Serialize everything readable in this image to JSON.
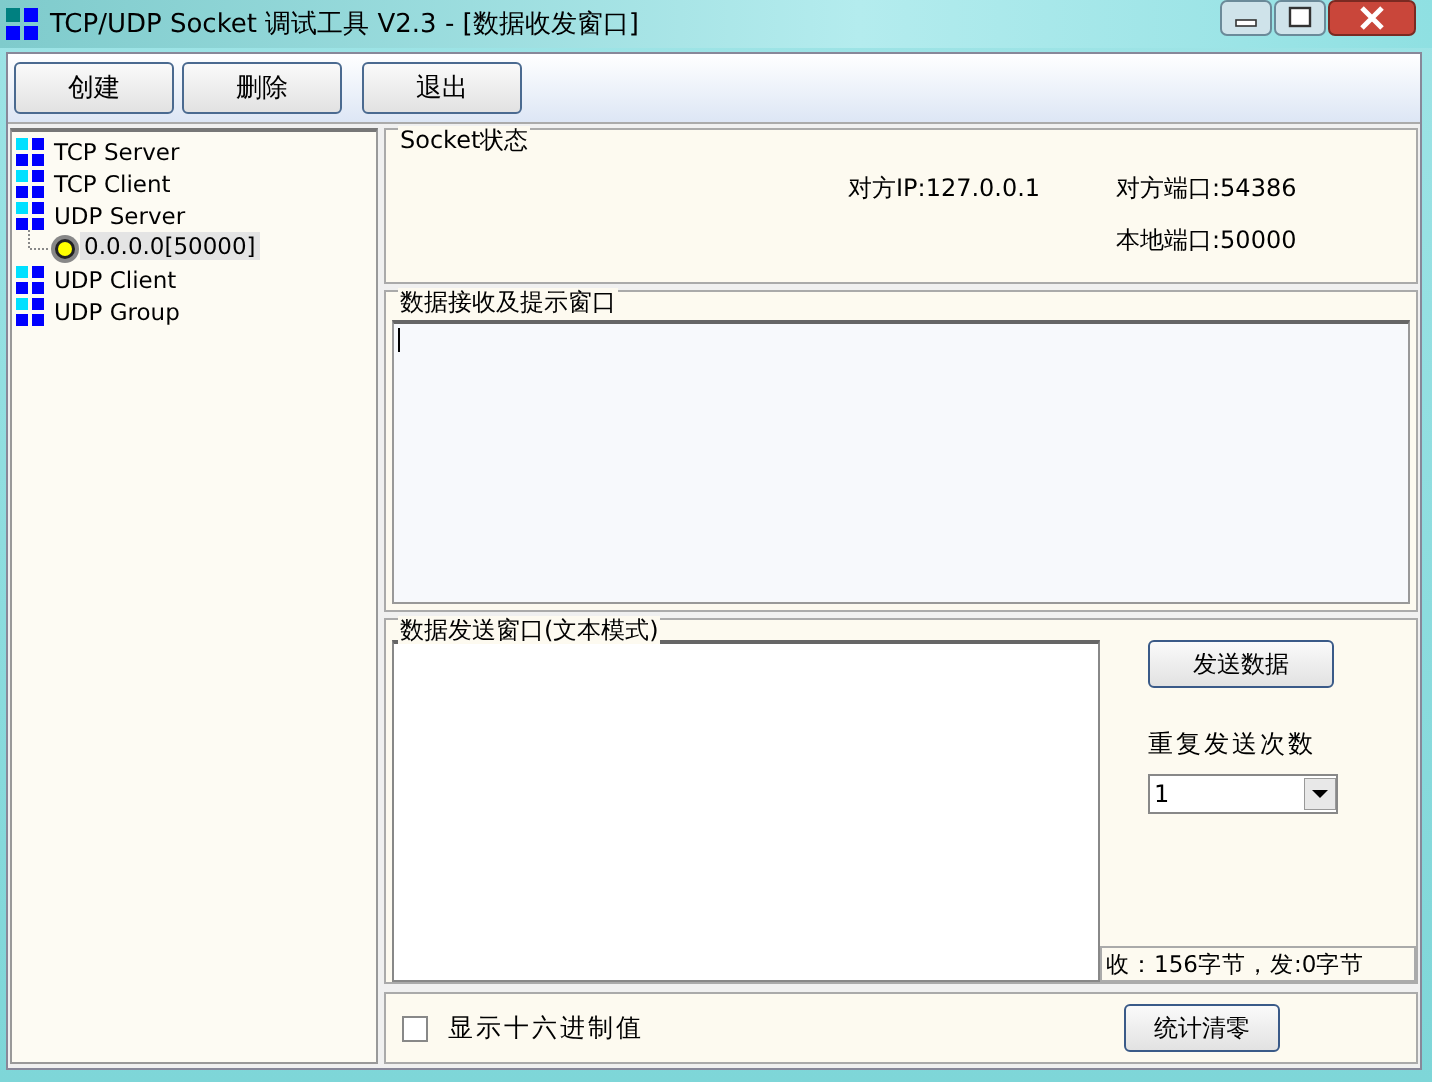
{
  "window": {
    "title": "TCP/UDP Socket 调试工具 V2.3 - [数据收发窗口]"
  },
  "toolbar": [
    "创建",
    "删除",
    "退出"
  ],
  "tree": [
    {
      "label": "TCP Server",
      "kind": "group",
      "selected": false
    },
    {
      "label": "TCP Client",
      "kind": "group",
      "selected": false
    },
    {
      "label": "UDP Server",
      "kind": "group",
      "selected": false,
      "children": [
        {
          "label": "0.0.0.0[50000]",
          "kind": "socket",
          "selected": true
        }
      ]
    },
    {
      "label": "UDP Client",
      "kind": "group",
      "selected": false
    },
    {
      "label": "UDP Group",
      "kind": "group",
      "selected": false
    }
  ],
  "socket_status": {
    "title": "Socket状态",
    "remote_ip": "对方IP:127.0.0.1",
    "remote_port": "对方端口:54386",
    "local_port": "本地端口:50000"
  },
  "receive": {
    "title": "数据接收及提示窗口"
  },
  "send": {
    "title": "数据发送窗口(文本模式)",
    "send_button": "发送数据",
    "repeat_label": "重复发送次数",
    "repeat_value": "1",
    "stats": "收：156字节，发:0字节"
  },
  "hex_checkbox": {
    "label": "显示十六进制值",
    "checked": false
  },
  "clear_button": "统计清零"
}
